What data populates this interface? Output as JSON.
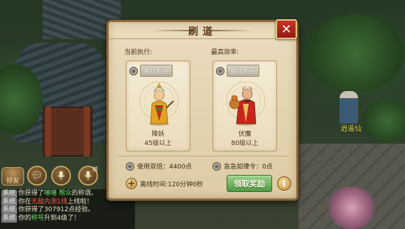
{
  "dialog": {
    "title": "刷道",
    "close_symbol": "✕",
    "current_label": "当前执行:",
    "best_label": "最高效率:",
    "cards": [
      {
        "badge": "离线刷道",
        "name": "降妖",
        "level": "45级以上",
        "icon": "demon-subduer-portrait-icon"
      },
      {
        "badge": "离线刷道",
        "name": "伏魔",
        "level": "80级以上",
        "icon": "demon-vanquisher-portrait-icon"
      }
    ],
    "options": [
      {
        "label": "使用双倍：4400点"
      },
      {
        "label": "急急如律令：0点"
      }
    ],
    "offline_time": "离线时间:120分钟0秒",
    "plus_symbol": "+",
    "claim_label": "领取奖励",
    "info_symbol": "i"
  },
  "scene": {
    "npc_name": "逍遥仙"
  },
  "hud": {
    "friend_label": "好友",
    "help_label": "帮",
    "chat_icon": "chat-bubble-icon",
    "mic_icon": "microphone-icon"
  },
  "chat": {
    "lines": [
      {
        "tag": "系统",
        "text_a": "你获得了",
        "highlight": "嘻嘻 帮众",
        "text_b": "的称谓。",
        "hl_color": "green"
      },
      {
        "tag": "系统",
        "text_a": "你在",
        "highlight": "无敌内测1线",
        "text_b": "上线啦！",
        "hl_color": "red"
      },
      {
        "tag": "系统",
        "text_a": "你获得了307912点经验。",
        "highlight": "",
        "text_b": "",
        "hl_color": "green"
      },
      {
        "tag": "系统",
        "text_a": "你的",
        "highlight": "称号",
        "text_b": "升到4级了！",
        "hl_color": "green"
      }
    ]
  },
  "colors": {
    "dialog_bg": "#e9dcbd",
    "dialog_border": "#8a6a3c",
    "close_red": "#c9332a",
    "claim_green": "#4f9a43",
    "npc_name_yellow": "#e4e85a"
  }
}
